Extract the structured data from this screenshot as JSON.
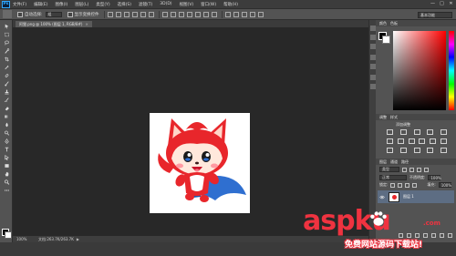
{
  "app": {
    "logo_text": "Ps"
  },
  "menu": {
    "items": [
      "文件(F)",
      "编辑(E)",
      "图像(I)",
      "图层(L)",
      "类型(Y)",
      "选择(S)",
      "滤镜(T)",
      "3D(D)",
      "视图(V)",
      "窗口(W)",
      "帮助(H)"
    ]
  },
  "window_controls": {
    "minimize": "—",
    "maximize": "□",
    "close": "✕"
  },
  "options_bar": {
    "auto_select_label": "自动选择:",
    "auto_select_value": "组",
    "show_transform_label": "显示变换控件",
    "workspace_value": "基本功能"
  },
  "document_tab": {
    "title": "阿狸.png @ 100% (图层 1, RGB/8#)",
    "close": "×"
  },
  "status_bar": {
    "zoom": "100%",
    "doc_info": "文档:263.7K/263.7K",
    "arrow": "▶"
  },
  "panels": {
    "color_tabs": [
      "颜色",
      "色板"
    ],
    "adjust_tabs": [
      "调整",
      "样式"
    ],
    "adjust_title": "添加调整",
    "layer_tabs": [
      "图层",
      "通道",
      "路径"
    ],
    "kind_label": "类型",
    "blend_mode": "正常",
    "opacity_label": "不透明度:",
    "opacity_value": "100%",
    "lock_label": "锁定:",
    "fill_label": "填充:",
    "fill_value": "100%",
    "layer_name": "图层 1"
  },
  "colors": {
    "foreground": "#000000",
    "background": "#ffffff",
    "character_red": "#e8262b",
    "cape_blue": "#2f6fd0",
    "layer_selected": "#5d6d83"
  },
  "watermark": {
    "main": "aspku",
    "domain_suffix": ".com",
    "sub": "免费网站源码下载站!"
  }
}
